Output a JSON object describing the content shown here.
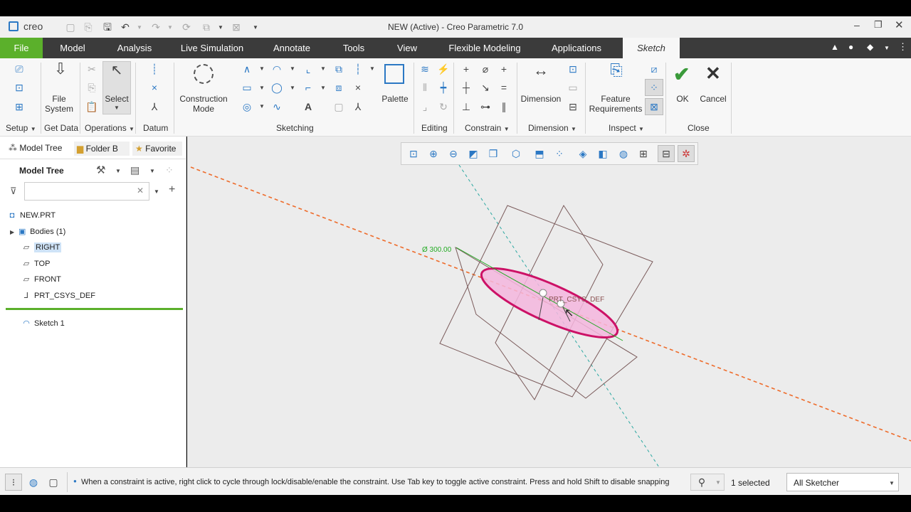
{
  "window": {
    "app_logo": "creo",
    "title": "NEW (Active) - Creo Parametric 7.0"
  },
  "menu": {
    "tabs": [
      "File",
      "Model",
      "Analysis",
      "Live Simulation",
      "Annotate",
      "Tools",
      "View",
      "Flexible Modeling",
      "Applications",
      "Sketch"
    ],
    "active": "Sketch"
  },
  "ribbon": {
    "groups": {
      "setup": "Setup",
      "get_data": "Get Data",
      "operations": "Operations",
      "datum": "Datum",
      "sketching": "Sketching",
      "editing": "Editing",
      "constrain": "Constrain",
      "dimension": "Dimension",
      "inspect": "Inspect",
      "close": "Close"
    },
    "buttons": {
      "file_system": "File\nSystem",
      "select": "Select",
      "construction_mode": "Construction\nMode",
      "palette": "Palette",
      "dimension": "Dimension",
      "feature_requirements": "Feature\nRequirements",
      "ok": "OK",
      "cancel": "Cancel"
    }
  },
  "left_panel": {
    "tabs": [
      "Model Tree",
      "Folder B",
      "Favorite"
    ],
    "header": "Model Tree",
    "search_placeholder": "",
    "items": [
      {
        "label": "NEW.PRT",
        "icon": "part-icon"
      },
      {
        "label": "Bodies (1)",
        "icon": "bodies-icon"
      },
      {
        "label": "RIGHT",
        "icon": "datum-plane-icon",
        "selected": true
      },
      {
        "label": "TOP",
        "icon": "datum-plane-icon"
      },
      {
        "label": "FRONT",
        "icon": "datum-plane-icon"
      },
      {
        "label": "PRT_CSYS_DEF",
        "icon": "csys-icon"
      }
    ],
    "insert_items": [
      {
        "label": "Sketch 1",
        "icon": "sketch-icon"
      }
    ]
  },
  "canvas": {
    "dimension_text": "Ø 300.00",
    "csys_label": "PRT_CSYS_DEF"
  },
  "status": {
    "message": "When a constraint is active, right click to cycle through lock/disable/enable the constraint. Use Tab key to toggle active constraint. Press and hold Shift to disable snapping",
    "selected": "1 selected",
    "filter": "All Sketcher"
  },
  "colors": {
    "file_tab": "#5bb02b",
    "ellipse": "#cc1166",
    "ellipse_fill": "#f4b6de",
    "dashed_line": "#ee6b2a",
    "centerline": "#2aa7a0",
    "dimension": "#22aa22",
    "plane": "#7a5a5a"
  }
}
